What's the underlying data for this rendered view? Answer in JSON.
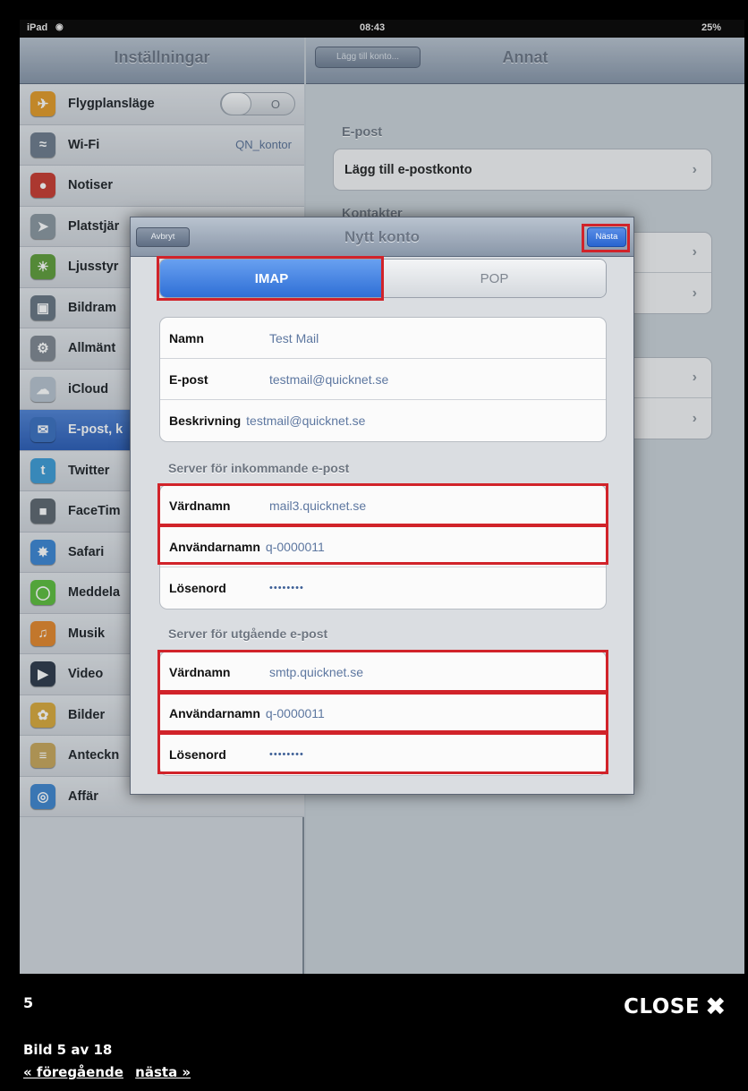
{
  "statusbar": {
    "device": "iPad",
    "wifi_glyph": "◉",
    "time": "08:43",
    "battery": "25%"
  },
  "left": {
    "title": "Inställningar",
    "items": [
      {
        "label": "Flygplansläge",
        "icon": "airplane-icon",
        "color": "#e39a26",
        "glyph": "✈",
        "toggle": "O"
      },
      {
        "label": "Wi-Fi",
        "icon": "wifi-icon",
        "color": "#6d7b8c",
        "glyph": "≈",
        "value": "QN_kontor"
      },
      {
        "label": "Notiser",
        "icon": "notifications-icon",
        "color": "#c83a2f",
        "glyph": "●"
      },
      {
        "label": "Platstjär",
        "icon": "location-icon",
        "color": "#8a969f",
        "glyph": "➤"
      },
      {
        "label": "Ljusstyr",
        "icon": "brightness-icon",
        "color": "#5f9d39",
        "glyph": "☀"
      },
      {
        "label": "Bildram",
        "icon": "picture-frame-icon",
        "color": "#677582",
        "glyph": "▣"
      },
      {
        "label": "Allmänt",
        "icon": "general-gear-icon",
        "color": "#7f8790",
        "glyph": "⚙"
      },
      {
        "label": "iCloud",
        "icon": "icloud-icon",
        "color": "#b8c3cf",
        "glyph": "☁"
      },
      {
        "label": "E-post, k",
        "icon": "mail-icon",
        "color": "#3a6fc0",
        "glyph": "✉",
        "selected": true
      },
      {
        "label": "Twitter",
        "icon": "twitter-icon",
        "color": "#3c9bd6",
        "glyph": "t"
      },
      {
        "label": "FaceTim",
        "icon": "facetime-icon",
        "color": "#5d666e",
        "glyph": "■"
      },
      {
        "label": "Safari",
        "icon": "safari-icon",
        "color": "#3b86d4",
        "glyph": "✸"
      },
      {
        "label": "Meddela",
        "icon": "messages-icon",
        "color": "#5cbe3b",
        "glyph": "◯"
      },
      {
        "label": "Musik",
        "icon": "music-icon",
        "color": "#e4872a",
        "glyph": "♫"
      },
      {
        "label": "Video",
        "icon": "video-icon",
        "color": "#2d3848",
        "glyph": "▶"
      },
      {
        "label": "Bilder",
        "icon": "photos-icon",
        "color": "#d9a93a",
        "glyph": "✿"
      },
      {
        "label": "Anteckn",
        "icon": "notes-icon",
        "color": "#c9a65a",
        "glyph": "≡"
      },
      {
        "label": "Affär",
        "icon": "store-icon",
        "color": "#3f86cf",
        "glyph": "◎"
      }
    ]
  },
  "right": {
    "back_label": "Lägg till konto...",
    "title": "Annat",
    "section_mail": "E-post",
    "add_mail_label": "Lägg till e-postkonto",
    "section_contacts": "Kontakter",
    "chevron": "›"
  },
  "modal": {
    "cancel_label": "Avbryt",
    "title": "Nytt konto",
    "next_label": "Nästa",
    "tabs": {
      "imap": "IMAP",
      "pop": "POP"
    },
    "account": [
      {
        "label": "Namn",
        "value": "Test Mail"
      },
      {
        "label": "E-post",
        "value": "testmail@quicknet.se"
      },
      {
        "label": "Beskrivning",
        "value": "testmail@quicknet.se"
      }
    ],
    "incoming_title": "Server för inkommande e-post",
    "incoming": [
      {
        "label": "Värdnamn",
        "value": "mail3.quicknet.se"
      },
      {
        "label": "Användarnamn",
        "value": "q-0000011"
      },
      {
        "label": "Lösenord",
        "value": "••••••••"
      }
    ],
    "outgoing_title": "Server för utgående e-post",
    "outgoing": [
      {
        "label": "Värdnamn",
        "value": "smtp.quicknet.se"
      },
      {
        "label": "Användarnamn",
        "value": "q-0000011"
      },
      {
        "label": "Lösenord",
        "value": "••••••••"
      }
    ],
    "highlight_color": "#d1232a"
  },
  "gallery": {
    "number": "5",
    "close_label": "CLOSE",
    "close_glyph": "✖",
    "caption": "Bild 5 av 18",
    "prev_label": "« föregående",
    "next_label": "nästa »"
  }
}
